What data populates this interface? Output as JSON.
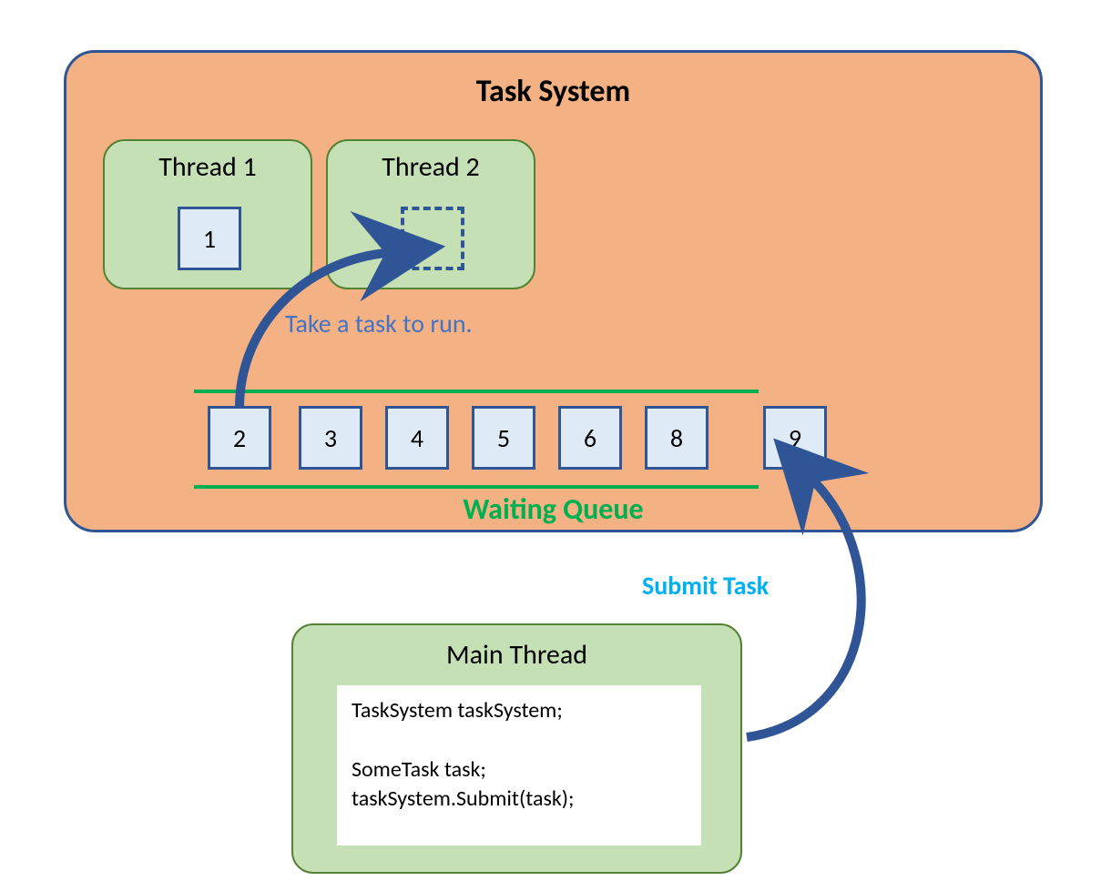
{
  "title": "Task System",
  "threads": [
    {
      "label": "Thread 1",
      "task": "1",
      "placeholder": false
    },
    {
      "label": "Thread 2",
      "task": "",
      "placeholder": true
    }
  ],
  "take_label": "Take a task to run.",
  "queue": {
    "label": "Waiting Queue",
    "items": [
      "2",
      "3",
      "4",
      "5",
      "6",
      "8"
    ],
    "incoming": "9"
  },
  "submit_label": "Submit Task",
  "main_thread": {
    "label": "Main Thread",
    "code": "TaskSystem taskSystem;\n\nSomeTask task;\ntaskSystem.Submit(task);"
  },
  "colors": {
    "panel": "#f4b183",
    "panel_border": "#2f5597",
    "thread_bg": "#c5e0b4",
    "thread_border": "#548235",
    "cell_bg": "#deebf7",
    "queue_line": "#00b050",
    "arrow": "#2f5597",
    "take_text": "#4472c4",
    "submit_text": "#00b0f0"
  }
}
